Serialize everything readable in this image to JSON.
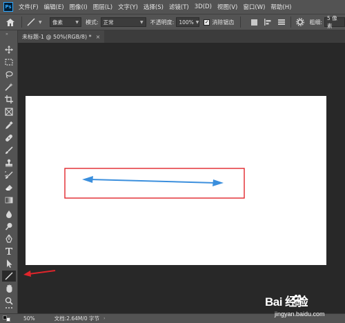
{
  "menubar": {
    "app_icon": "Ps",
    "items": [
      "文件(F)",
      "编辑(E)",
      "图像(I)",
      "图层(L)",
      "文字(Y)",
      "选择(S)",
      "滤镜(T)",
      "3D(D)",
      "视图(V)",
      "窗口(W)",
      "帮助(H)"
    ]
  },
  "options": {
    "unit": "像素",
    "mode_label": "模式:",
    "mode_value": "正常",
    "opacity_label": "不透明度:",
    "opacity_value": "100%",
    "antialias_label": "消除锯齿",
    "antialias_checked": true,
    "weight_label": "粗细:",
    "weight_value": "5 像素"
  },
  "document": {
    "tab_title": "未标题-1 @ 50%(RGB/8) *",
    "close_icon": "×"
  },
  "canvas": {
    "arrow_color": "#3b8fdd",
    "highlight_color": "#e0252b",
    "pointer_color": "#e0252b",
    "background": "#ffffff"
  },
  "status": {
    "zoom": "50%",
    "doc_info": "文档:2.64M/0 字节"
  },
  "watermark": {
    "title": "Bai  经验",
    "subtitle": "jingyan.baidu.com"
  },
  "icons": [
    "home-icon",
    "line-tool-icon",
    "move-icon",
    "marquee-icon",
    "lasso-icon",
    "magic-wand-icon",
    "crop-icon",
    "frame-icon",
    "eyedropper-icon",
    "healing-icon",
    "brush-icon",
    "stamp-icon",
    "history-brush-icon",
    "eraser-icon",
    "gradient-icon",
    "blur-icon",
    "dodge-icon",
    "pen-icon",
    "type-icon",
    "path-selection-icon",
    "line-icon",
    "hand-icon",
    "zoom-icon",
    "more-icon"
  ]
}
